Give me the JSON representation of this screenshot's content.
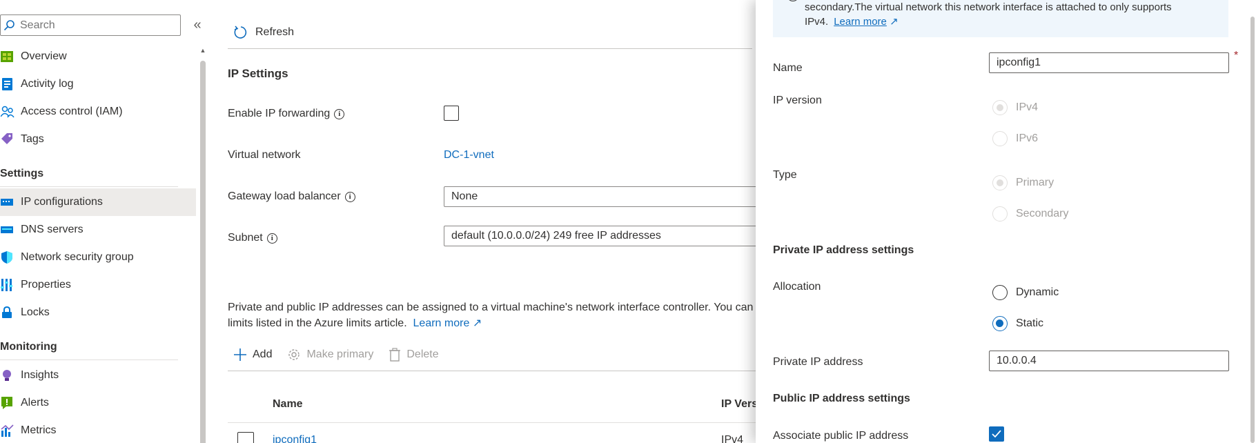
{
  "sidebar": {
    "search_placeholder": "Search",
    "collapse_glyph": "«",
    "items_top": [
      {
        "label": "Overview",
        "icon": "overview-icon"
      },
      {
        "label": "Activity log",
        "icon": "activity-log-icon"
      },
      {
        "label": "Access control (IAM)",
        "icon": "iam-icon"
      },
      {
        "label": "Tags",
        "icon": "tag-icon"
      }
    ],
    "section_settings": "Settings",
    "items_settings": [
      {
        "label": "IP configurations",
        "icon": "ip-config-icon"
      },
      {
        "label": "DNS servers",
        "icon": "dns-icon"
      },
      {
        "label": "Network security group",
        "icon": "shield-icon"
      },
      {
        "label": "Properties",
        "icon": "properties-icon"
      },
      {
        "label": "Locks",
        "icon": "lock-icon"
      }
    ],
    "section_monitoring": "Monitoring",
    "items_monitoring": [
      {
        "label": "Insights",
        "icon": "insights-icon"
      },
      {
        "label": "Alerts",
        "icon": "alert-icon"
      },
      {
        "label": "Metrics",
        "icon": "metrics-icon"
      }
    ]
  },
  "main": {
    "refresh_label": "Refresh",
    "ip_settings_title": "IP Settings",
    "enable_ip_forwarding_label": "Enable IP forwarding",
    "virtual_network_label": "Virtual network",
    "virtual_network_value": "DC-1-vnet",
    "gateway_lb_label": "Gateway load balancer",
    "gateway_lb_value": "None",
    "subnet_label": "Subnet",
    "subnet_value": "default (10.0.0.0/24) 249 free IP addresses",
    "desc_text": "Private and public IP addresses can be assigned to a virtual machine's network interface controller. You can",
    "desc_text2": "limits listed in the Azure limits article.",
    "desc_link": "Learn more",
    "cmd_add": "Add",
    "cmd_make_primary": "Make primary",
    "cmd_delete": "Delete",
    "table": {
      "col_name": "Name",
      "col_ip_version": "IP Vers",
      "rows": [
        {
          "name": "ipconfig1",
          "ip_version": "IPv4"
        }
      ]
    }
  },
  "panel": {
    "banner_text_1": "secondary.The virtual network this network interface is attached to only supports",
    "banner_text_2": "IPv4.",
    "banner_link": "Learn more",
    "name_label": "Name",
    "name_value": "ipconfig1",
    "required_star": "*",
    "ip_version_label": "IP version",
    "ipv4_label": "IPv4",
    "ipv6_label": "IPv6",
    "type_label": "Type",
    "primary_label": "Primary",
    "secondary_label": "Secondary",
    "private_settings_title": "Private IP address settings",
    "allocation_label": "Allocation",
    "dynamic_label": "Dynamic",
    "static_label": "Static",
    "private_ip_label": "Private IP address",
    "private_ip_value": "10.0.0.4",
    "public_settings_title": "Public IP address settings",
    "associate_public_label": "Associate public IP address"
  },
  "colors": {
    "accent": "#0f6cbd",
    "selected_bg": "#edebe9"
  }
}
